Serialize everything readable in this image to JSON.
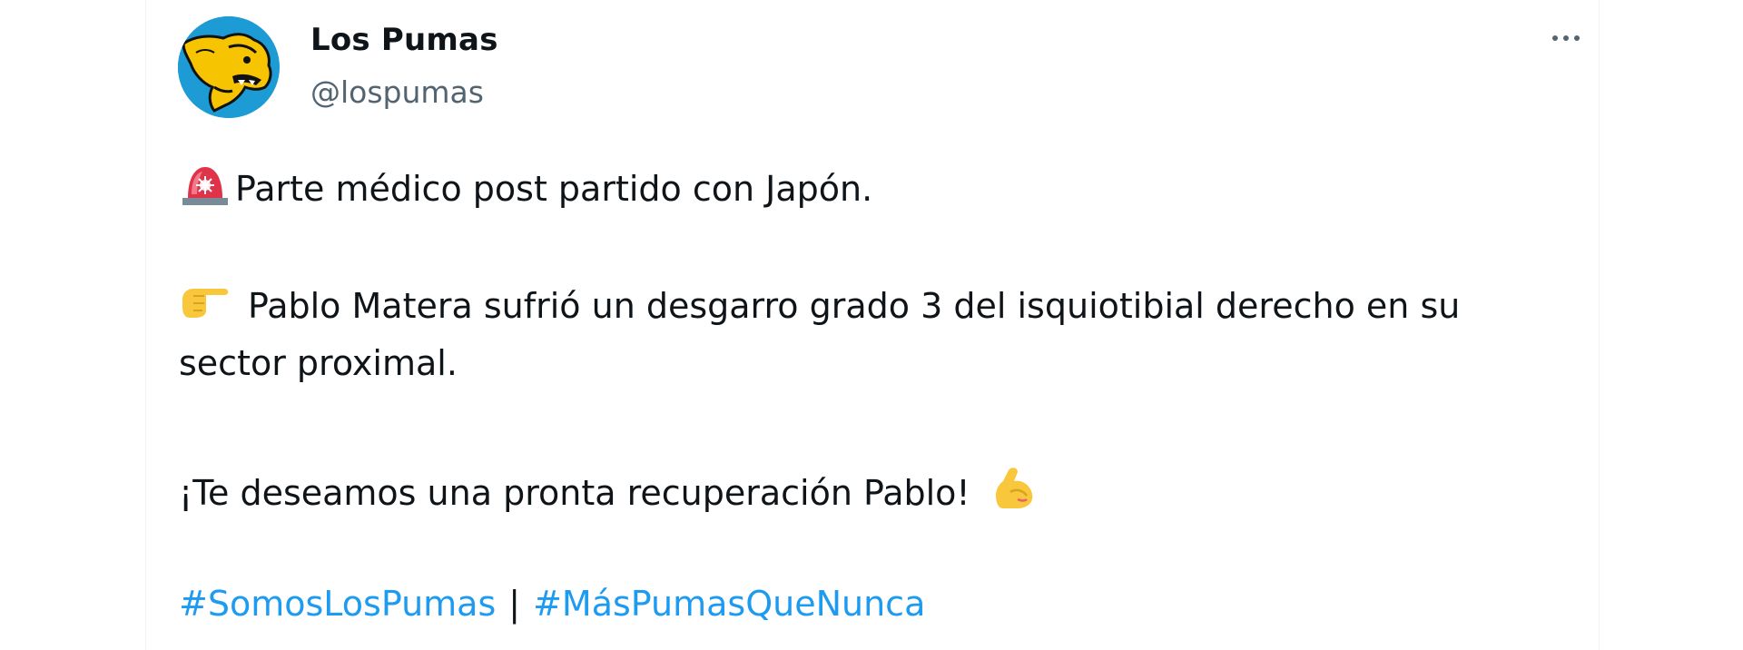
{
  "author": {
    "display_name": "Los Pumas",
    "handle": "@lospumas",
    "avatar_icon": "puma-logo-icon",
    "avatar_colors": {
      "background": "#1d9bd4",
      "puma": "#f6c400",
      "outline": "#111111"
    }
  },
  "menu": {
    "icon": "more-options-icon"
  },
  "tweet": {
    "line1": {
      "emoji": "police-light-icon",
      "text": "Parte médico post partido con Japón."
    },
    "line2": {
      "emoji": "pointing-right-hand-icon",
      "text": "Pablo Matera sufrió un desgarro grado 3 del isquiotibial derecho en su"
    },
    "line3": {
      "text": "sector proximal."
    },
    "line4": {
      "text": "¡Te deseamos una pronta recuperación Pablo!",
      "emoji": "flexed-biceps-icon"
    },
    "hashtags": [
      "#SomosLosPumas",
      "#MásPumasQueNunca"
    ],
    "separator": "|"
  },
  "colors": {
    "text": "#0f1419",
    "secondary": "#536471",
    "link": "#1d9bf0"
  }
}
